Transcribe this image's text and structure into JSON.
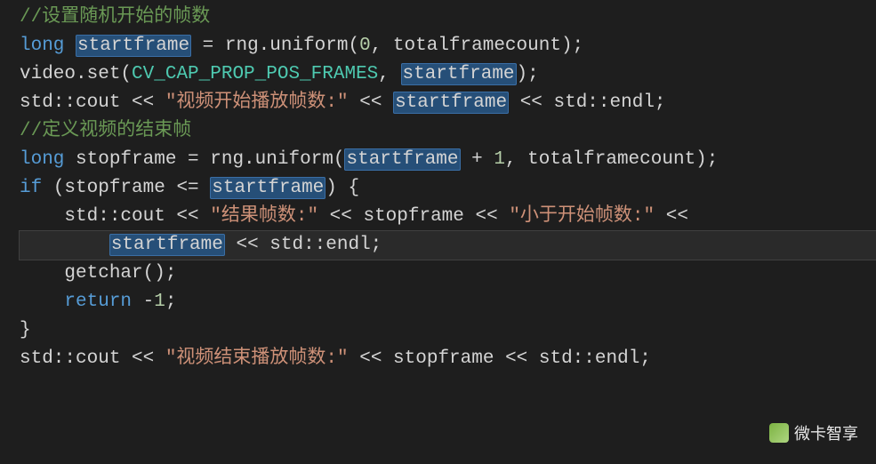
{
  "lines": [
    {
      "current": false,
      "indent": 0,
      "tokens": [
        {
          "cls": "comment",
          "txt": "//设置随机开始的帧数",
          "hl": false
        }
      ]
    },
    {
      "current": false,
      "indent": 0,
      "tokens": [
        {
          "cls": "keyword",
          "txt": "long",
          "hl": false
        },
        {
          "cls": "id",
          "txt": " ",
          "hl": false
        },
        {
          "cls": "id",
          "txt": "startframe",
          "hl": true
        },
        {
          "cls": "id",
          "txt": " = rng.uniform(",
          "hl": false
        },
        {
          "cls": "num",
          "txt": "0",
          "hl": false
        },
        {
          "cls": "id",
          "txt": ", totalframecount);",
          "hl": false
        }
      ]
    },
    {
      "current": false,
      "indent": 0,
      "tokens": [
        {
          "cls": "id",
          "txt": "video.set(",
          "hl": false
        },
        {
          "cls": "macro",
          "txt": "CV_CAP_PROP_POS_FRAMES",
          "hl": false
        },
        {
          "cls": "id",
          "txt": ", ",
          "hl": false
        },
        {
          "cls": "id",
          "txt": "startframe",
          "hl": true
        },
        {
          "cls": "id",
          "txt": ");",
          "hl": false
        }
      ]
    },
    {
      "current": false,
      "indent": 0,
      "tokens": [
        {
          "cls": "id",
          "txt": "std::cout << ",
          "hl": false
        },
        {
          "cls": "string",
          "txt": "\"视频开始播放帧数:\"",
          "hl": false
        },
        {
          "cls": "id",
          "txt": " << ",
          "hl": false
        },
        {
          "cls": "id",
          "txt": "startframe",
          "hl": true
        },
        {
          "cls": "id",
          "txt": " << std::endl;",
          "hl": false
        }
      ]
    },
    {
      "current": false,
      "indent": 0,
      "tokens": [
        {
          "cls": "id",
          "txt": "",
          "hl": false
        }
      ]
    },
    {
      "current": false,
      "indent": 0,
      "tokens": [
        {
          "cls": "comment",
          "txt": "//定义视频的结束帧",
          "hl": false
        }
      ]
    },
    {
      "current": false,
      "indent": 0,
      "tokens": [
        {
          "cls": "keyword",
          "txt": "long",
          "hl": false
        },
        {
          "cls": "id",
          "txt": " stopframe = rng.uniform(",
          "hl": false
        },
        {
          "cls": "id",
          "txt": "startframe",
          "hl": true
        },
        {
          "cls": "id",
          "txt": " + ",
          "hl": false
        },
        {
          "cls": "num",
          "txt": "1",
          "hl": false
        },
        {
          "cls": "id",
          "txt": ", totalframecount);",
          "hl": false
        }
      ]
    },
    {
      "current": false,
      "indent": 0,
      "tokens": [
        {
          "cls": "keyword",
          "txt": "if",
          "hl": false
        },
        {
          "cls": "id",
          "txt": " (stopframe <= ",
          "hl": false
        },
        {
          "cls": "id",
          "txt": "startframe",
          "hl": true
        },
        {
          "cls": "id",
          "txt": ") {",
          "hl": false
        }
      ]
    },
    {
      "current": false,
      "indent": 1,
      "tokens": [
        {
          "cls": "id",
          "txt": "    std::cout << ",
          "hl": false
        },
        {
          "cls": "string",
          "txt": "\"结果帧数:\"",
          "hl": false
        },
        {
          "cls": "id",
          "txt": " << stopframe << ",
          "hl": false
        },
        {
          "cls": "string",
          "txt": "\"小于开始帧数:\"",
          "hl": false
        },
        {
          "cls": "id",
          "txt": " <<",
          "hl": false
        }
      ]
    },
    {
      "current": true,
      "indent": 2,
      "tokens": [
        {
          "cls": "id",
          "txt": "        ",
          "hl": false
        },
        {
          "cls": "id",
          "txt": "startframe",
          "hl": true
        },
        {
          "cls": "id",
          "txt": " << std::endl;",
          "hl": false
        }
      ]
    },
    {
      "current": false,
      "indent": 1,
      "tokens": [
        {
          "cls": "id",
          "txt": "    getchar();",
          "hl": false
        }
      ]
    },
    {
      "current": false,
      "indent": 1,
      "tokens": [
        {
          "cls": "id",
          "txt": "    ",
          "hl": false
        },
        {
          "cls": "keyword",
          "txt": "return",
          "hl": false
        },
        {
          "cls": "id",
          "txt": " -",
          "hl": false
        },
        {
          "cls": "num",
          "txt": "1",
          "hl": false
        },
        {
          "cls": "id",
          "txt": ";",
          "hl": false
        }
      ]
    },
    {
      "current": false,
      "indent": 0,
      "tokens": [
        {
          "cls": "id",
          "txt": "}",
          "hl": false
        }
      ]
    },
    {
      "current": false,
      "indent": 0,
      "tokens": [
        {
          "cls": "id",
          "txt": "std::cout << ",
          "hl": false
        },
        {
          "cls": "string",
          "txt": "\"视频结束播放帧数:\"",
          "hl": false
        },
        {
          "cls": "id",
          "txt": " << stopframe << std::endl;",
          "hl": false
        }
      ]
    }
  ],
  "watermark": {
    "text": "微卡智享"
  }
}
